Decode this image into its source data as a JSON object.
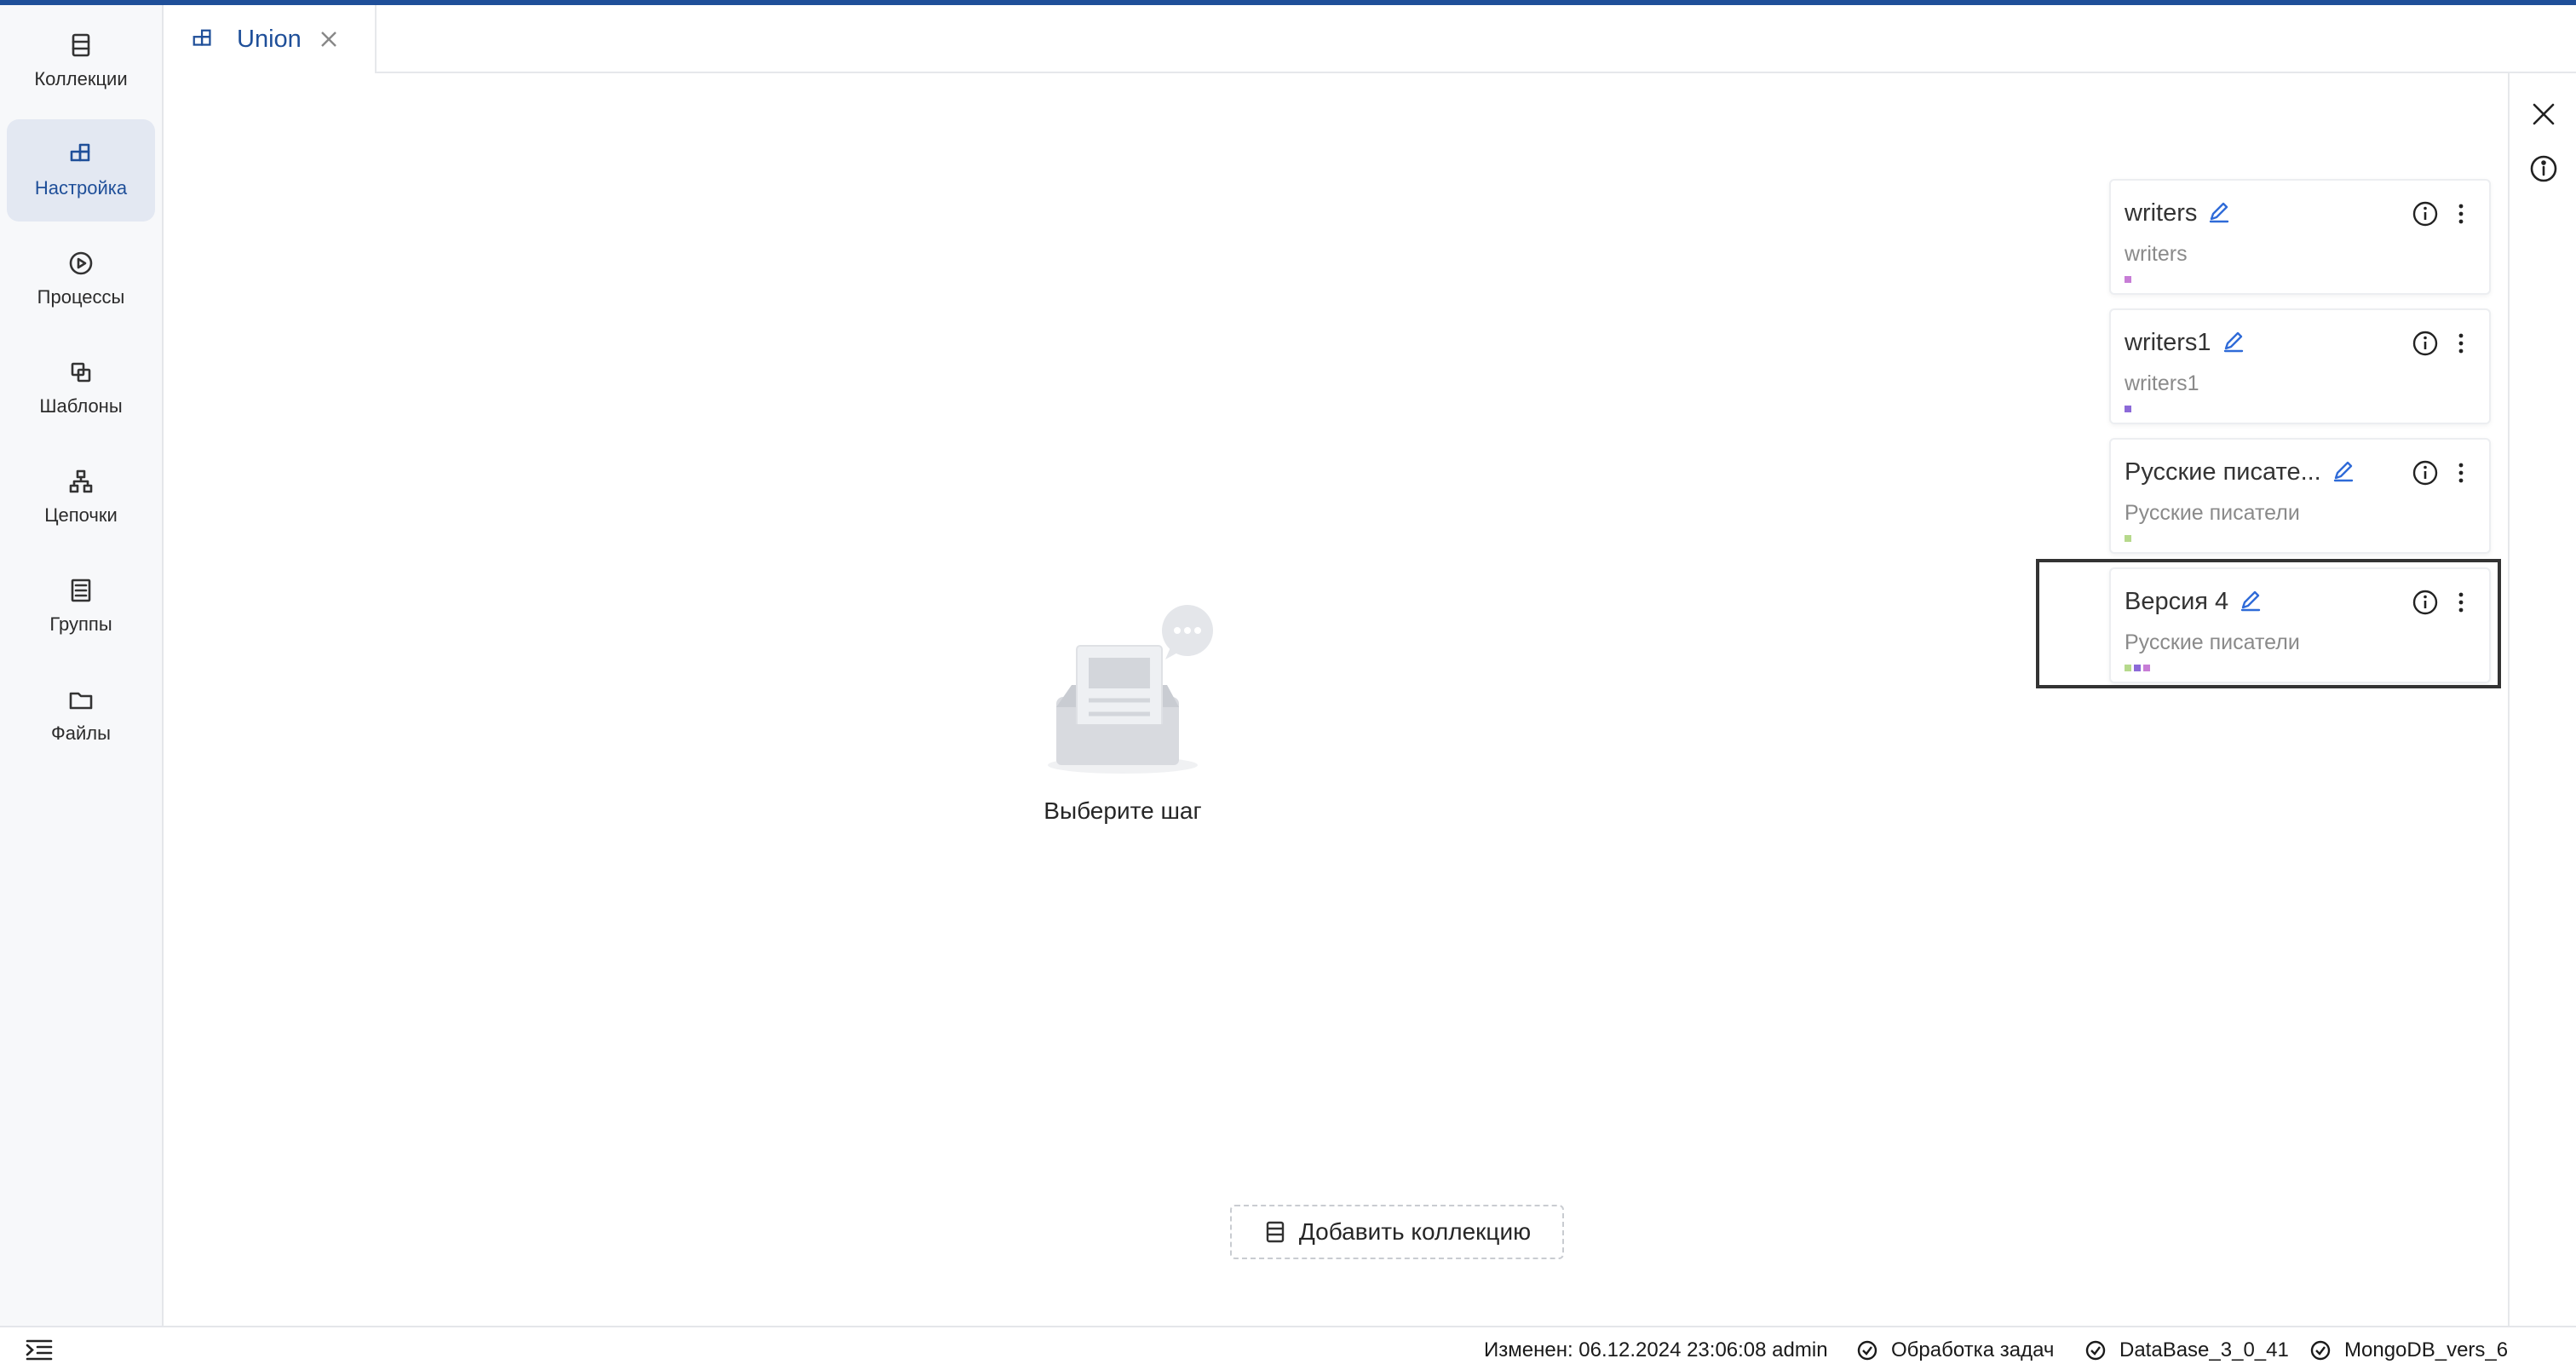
{
  "sidebar": {
    "items": [
      {
        "label": "Коллекции",
        "icon": "collection-icon",
        "active": false
      },
      {
        "label": "Настройка",
        "icon": "setup-icon",
        "active": true
      },
      {
        "label": "Процессы",
        "icon": "play-circle-icon",
        "active": false
      },
      {
        "label": "Шаблоны",
        "icon": "template-icon",
        "active": false
      },
      {
        "label": "Цепочки",
        "icon": "chain-icon",
        "active": false
      },
      {
        "label": "Группы",
        "icon": "group-icon",
        "active": false
      },
      {
        "label": "Файлы",
        "icon": "folder-icon",
        "active": false
      }
    ]
  },
  "tabs": [
    {
      "label": "Union",
      "icon": "setup-icon"
    }
  ],
  "main": {
    "empty_text": "Выберите шаг",
    "add_collection_label": "Добавить коллекцию"
  },
  "cards": [
    {
      "title": "writers",
      "subtitle": "writers",
      "tags": [
        "#c77dd6"
      ]
    },
    {
      "title": "writers1",
      "subtitle": "writers1",
      "tags": [
        "#8c6ad8"
      ]
    },
    {
      "title": "Русские писате...",
      "subtitle": "Русские писатели",
      "tags": [
        "#b6d98c"
      ]
    },
    {
      "title": "Версия 4",
      "subtitle": "Русские писатели",
      "tags": [
        "#b6d98c",
        "#8c6ad8",
        "#c77dd6"
      ],
      "selected": true
    }
  ],
  "footer": {
    "modified": "Изменен: 06.12.2024 23:06:08 admin",
    "task_processing": "Обработка задач",
    "database": "DataBase_3_0_41",
    "mongo": "MongoDB_vers_6"
  },
  "colors": {
    "accent": "#1f4f99",
    "edit_icon": "#2f6bd8",
    "sidebar_bg": "#f7f8fa",
    "active_bg": "#e3e8f2"
  }
}
